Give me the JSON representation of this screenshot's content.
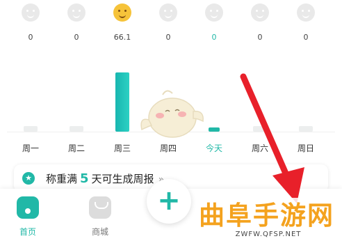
{
  "week": [
    {
      "label": "周一",
      "value": "0",
      "level": 0,
      "face": "neutral",
      "today": false
    },
    {
      "label": "周二",
      "value": "0",
      "level": 0,
      "face": "neutral",
      "today": false
    },
    {
      "label": "周三",
      "value": "66.1",
      "level": 66.1,
      "face": "happy",
      "today": false
    },
    {
      "label": "周四",
      "value": "0",
      "level": 0,
      "face": "neutral",
      "today": false
    },
    {
      "label": "今天",
      "value": "0",
      "level": 0,
      "face": "neutral",
      "today": true
    },
    {
      "label": "周六",
      "value": "0",
      "level": 0,
      "face": "neutral",
      "today": false
    },
    {
      "label": "周日",
      "value": "0",
      "level": 0,
      "face": "neutral",
      "today": false
    }
  ],
  "report": {
    "prefix": "称重满",
    "days": "5",
    "suffix": "天可生成周报",
    "arrow": "»",
    "icon": "star-icon"
  },
  "tabbar": {
    "home_label": "首页",
    "mall_label": "商城",
    "add_label": "+"
  },
  "watermark": {
    "title": "曲阜手游网",
    "url": "ZWFW.QFSP.NET"
  },
  "colors": {
    "accent": "#21b8a7",
    "watermark": "#f4a21e",
    "arrow": "#e8202a"
  }
}
